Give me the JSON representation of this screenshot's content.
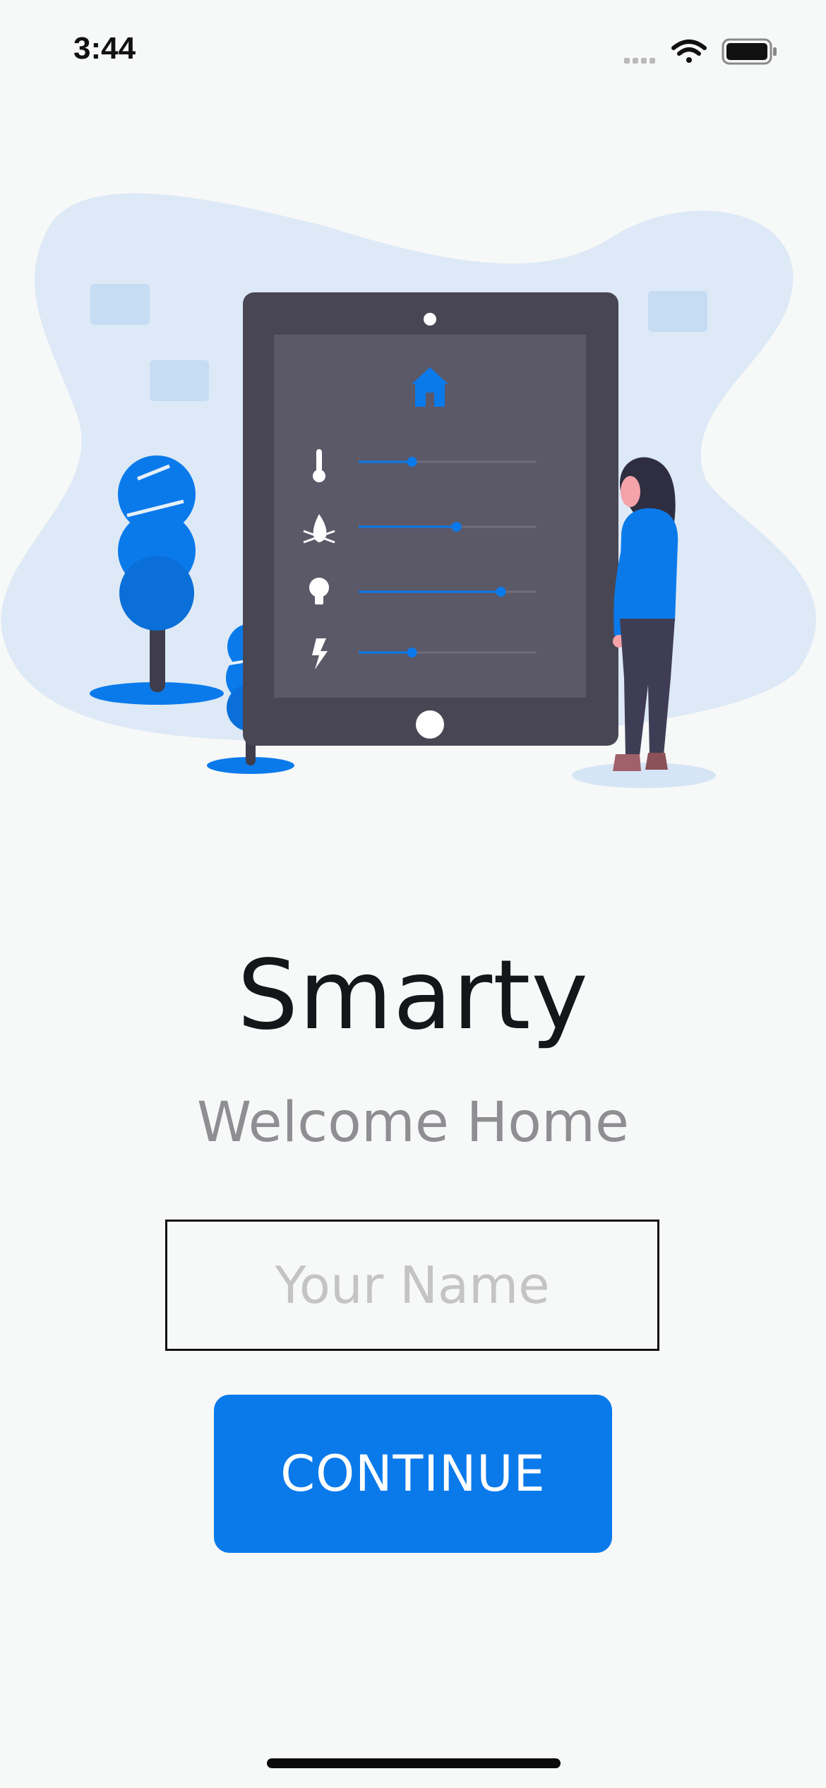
{
  "status_bar": {
    "time": "3:44",
    "icons": [
      "cellular-signal-icon",
      "wifi-icon",
      "battery-icon"
    ]
  },
  "illustration": {
    "icons": [
      "home-icon",
      "thermometer-icon",
      "flame-icon",
      "lightbulb-icon",
      "lightning-icon"
    ],
    "slider_levels": [
      0.3,
      0.55,
      0.8,
      0.3
    ],
    "colors": {
      "accent": "#0a7aeb",
      "tablet": "#484653",
      "screen": "#5b5868",
      "blob": "#dde9f6"
    }
  },
  "app": {
    "title": "Smarty",
    "subtitle": "Welcome Home"
  },
  "form": {
    "name_placeholder": "Your Name",
    "name_value": "",
    "continue_label": "CONTINUE"
  },
  "colors": {
    "background": "#f7f8f8",
    "accent": "#0a7aeb",
    "title": "#14171a",
    "subtitle": "#8e8e93"
  }
}
